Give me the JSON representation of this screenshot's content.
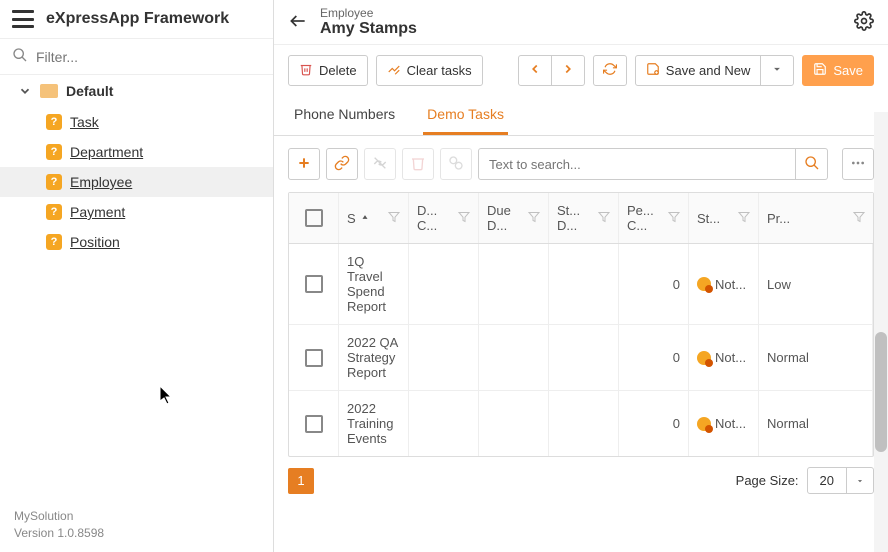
{
  "brand": "eXpressApp Framework",
  "filter": {
    "placeholder": "Filter..."
  },
  "tree": {
    "root": "Default",
    "items": [
      {
        "label": "Task",
        "active": false
      },
      {
        "label": "Department",
        "active": false
      },
      {
        "label": "Employee",
        "active": true
      },
      {
        "label": "Payment",
        "active": false
      },
      {
        "label": "Position",
        "active": false
      }
    ]
  },
  "footer": {
    "solution": "MySolution",
    "version": "Version 1.0.8598"
  },
  "header": {
    "entity": "Employee",
    "name": "Amy Stamps"
  },
  "toolbar": {
    "delete": "Delete",
    "clear": "Clear tasks",
    "save_new": "Save and New",
    "save": "Save"
  },
  "tabs": [
    {
      "label": "Phone Numbers",
      "active": false
    },
    {
      "label": "Demo Tasks",
      "active": true
    }
  ],
  "grid_toolbar": {
    "search_placeholder": "Text to search..."
  },
  "columns": {
    "subject": "S",
    "dc": "D... C...",
    "dd": "Due D...",
    "sd": "St... D...",
    "pc": "Pe... C...",
    "st": "St...",
    "pr": "Pr..."
  },
  "rows": [
    {
      "subject": "1Q Travel Spend Report",
      "pc": "0",
      "status": "Not...",
      "priority": "Low"
    },
    {
      "subject": "2022 QA Strategy Report",
      "pc": "0",
      "status": "Not...",
      "priority": "Normal"
    },
    {
      "subject": "2022 Training Events",
      "pc": "0",
      "status": "Not...",
      "priority": "Normal"
    }
  ],
  "pager": {
    "page": "1",
    "size_label": "Page Size:",
    "size": "20"
  }
}
